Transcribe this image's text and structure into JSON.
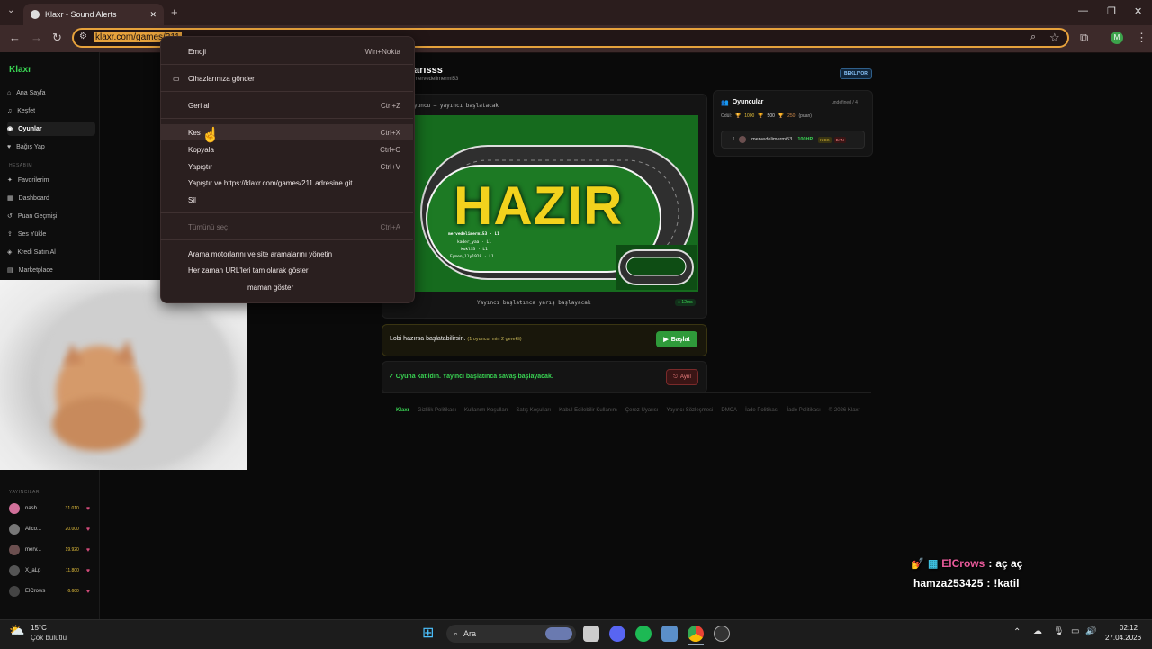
{
  "browser": {
    "tab_title": "Klaxr - Sound Alerts",
    "url": "klaxr.com/games/211",
    "profile_initial": "M"
  },
  "context_menu": {
    "items": [
      {
        "label": "Emoji",
        "shortcut": "Win+Nokta",
        "disabled": false
      },
      {
        "label": "Cihazlarınıza gönder",
        "shortcut": "",
        "disabled": false
      },
      {
        "label": "Geri al",
        "shortcut": "Ctrl+Z",
        "disabled": false
      },
      {
        "label": "Kes",
        "shortcut": "Ctrl+X",
        "disabled": false
      },
      {
        "label": "Kopyala",
        "shortcut": "Ctrl+C",
        "disabled": false
      },
      {
        "label": "Yapıştır",
        "shortcut": "Ctrl+V",
        "disabled": false
      },
      {
        "label": "Yapıştır ve https://klaxr.com/games/211 adresine git",
        "shortcut": "",
        "disabled": false
      },
      {
        "label": "Sil",
        "shortcut": "",
        "disabled": false
      },
      {
        "label": "Tümünü seç",
        "shortcut": "Ctrl+A",
        "disabled": true
      },
      {
        "label": "Arama motorlarını ve site aramalarını yönetin",
        "shortcut": "",
        "disabled": false
      },
      {
        "label": "Her zaman URL'leri tam olarak göster",
        "shortcut": "",
        "disabled": false
      },
      {
        "label": "maman göster",
        "shortcut": "",
        "disabled": false
      }
    ]
  },
  "sidebar": {
    "logo": "Klaxr",
    "nav": [
      {
        "label": "Ana Sayfa",
        "icon": "home-icon",
        "active": false
      },
      {
        "label": "Keşfet",
        "icon": "music-icon",
        "active": false
      },
      {
        "label": "Oyunlar",
        "icon": "gamepad-icon",
        "active": true
      },
      {
        "label": "Bağış Yap",
        "icon": "heart-icon",
        "active": false
      }
    ],
    "account_section": "HESABIM",
    "account": [
      {
        "label": "Favorilerim",
        "icon": "star-icon"
      },
      {
        "label": "Dashboard",
        "icon": "grid-icon"
      },
      {
        "label": "Puan Geçmişi",
        "icon": "history-icon"
      },
      {
        "label": "Ses Yükle",
        "icon": "upload-icon"
      },
      {
        "label": "Kredi Satın Al",
        "icon": "credit-icon"
      },
      {
        "label": "Marketplace",
        "icon": "store-icon"
      }
    ],
    "streamers_section": "YAYINCILAR",
    "streamers": [
      {
        "name": "nash...",
        "coins": "31.010",
        "color": "#d1709a"
      },
      {
        "name": "Alico...",
        "coins": "20.000",
        "color": "#888"
      },
      {
        "name": "merv...",
        "coins": "19.920",
        "color": "#6b4f4f"
      },
      {
        "name": "X_aLp",
        "coins": "11.800",
        "color": "#555"
      },
      {
        "name": "ElCrows",
        "coins": "6.600",
        "color": "#444"
      }
    ]
  },
  "game": {
    "title_partial": "arısss",
    "host_partial": "mervedelimermi53",
    "status_badge": "BEKLIYOR",
    "lobby_caption": "yuncu — yayıncı başlatacak",
    "overlay_text": "HAZIR",
    "racers": [
      "mervedelimermi53 · L1",
      "kader_yaa · L1",
      "kuklS3 · L1",
      "Eymen_lly1928 · L1"
    ],
    "footer_caption": "Yayıncı başlatınca yarış başlayacak",
    "timer": "● 12ms",
    "lobby_msg": "Lobi hazırsa başlatabilirsin.",
    "lobby_sub": "(1 oyuncu, min 2 gerekli)",
    "start_button": "Başlat",
    "joined_msg": "✓ Oyuna katıldın. Yayıncı başlatınca savaş başlayacak.",
    "leave_button": "Ayrıl"
  },
  "players": {
    "title": "Oyuncular",
    "count": "undefined / 4",
    "reward_label": "Ödül:",
    "rewards": [
      "1000",
      "500",
      "250"
    ],
    "reward_unit": "(puan)",
    "rows": [
      {
        "rank": "1",
        "name": "mervedelimermi53",
        "hp": "100HP",
        "kick": "KICK",
        "ban": "BAN"
      }
    ]
  },
  "footer": {
    "logo": "Klaxr",
    "links": [
      "Gizlilik Politikası",
      "Kullanım Koşulları",
      "Satış Koşulları",
      "Kabul Edilebilir Kullanım",
      "Çerez Uyarısı",
      "Yayıncı Sözleşmesi",
      "DMCA",
      "İade Politikası",
      "İade Politikası",
      "© 2026 Klaxr"
    ]
  },
  "chat": [
    {
      "user": "ElCrows",
      "msg": "aç aç",
      "color": "#e85a9a"
    },
    {
      "user": "hamza253425",
      "msg": "!katil",
      "color": "#ffffff"
    }
  ],
  "taskbar": {
    "weather_temp": "15°C",
    "weather_desc": "Çok bulutlu",
    "search_label": "Ara",
    "time": "02:12",
    "date": "27.04.2026"
  }
}
